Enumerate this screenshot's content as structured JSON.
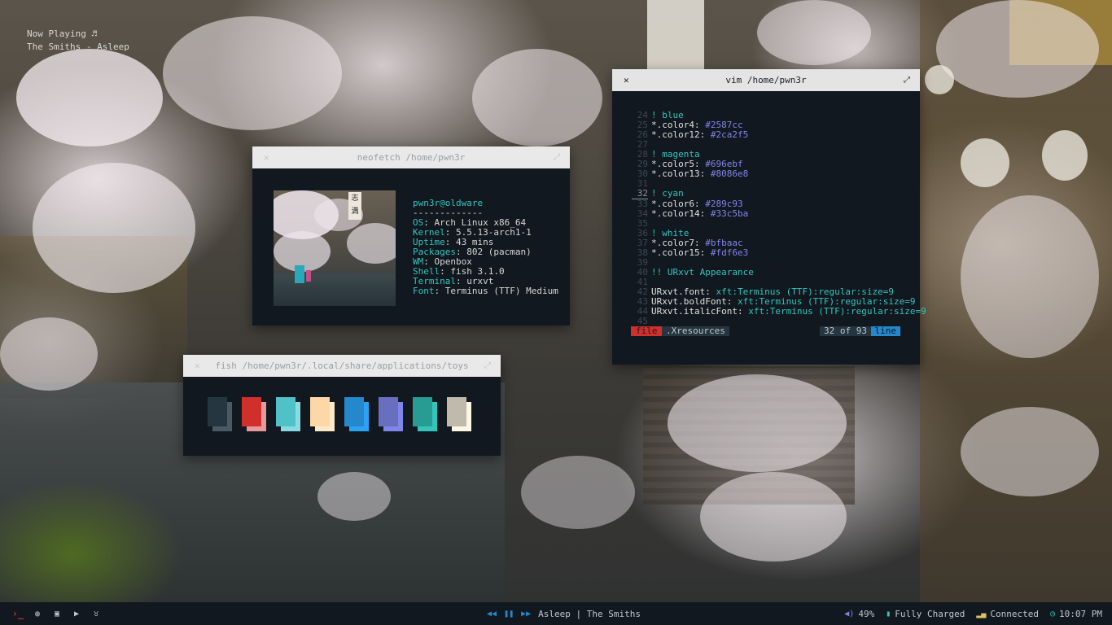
{
  "neofetch": {
    "title": "neofetch /home/pwn3r",
    "user_host": "pwn3r@oldware",
    "separator": "-------------",
    "rows": [
      {
        "key": "OS",
        "value": "Arch Linux x86_64"
      },
      {
        "key": "Kernel",
        "value": "5.5.13-arch1-1"
      },
      {
        "key": "Uptime",
        "value": "43 mins"
      },
      {
        "key": "Packages",
        "value": "802 (pacman)"
      },
      {
        "key": "WM",
        "value": "Openbox"
      },
      {
        "key": "Shell",
        "value": "fish 3.1.0"
      },
      {
        "key": "Terminal",
        "value": "urxvt"
      },
      {
        "key": "Font",
        "value": "Terminus (TTF) Medium"
      }
    ]
  },
  "fish": {
    "title": "fish /home/pwn3r/.local/share/applications/toys",
    "swatches": [
      {
        "front": "#263640",
        "back": "#4a5a64"
      },
      {
        "front": "#d12f2c",
        "back": "#e89a9a"
      },
      {
        "front": "#4fc1c7",
        "back": "#8adbdf"
      },
      {
        "front": "#fdd7a6",
        "back": "#ffe8c8"
      },
      {
        "front": "#2587cc",
        "back": "#2ca2f5"
      },
      {
        "front": "#696ebf",
        "back": "#8086e8"
      },
      {
        "front": "#289c93",
        "back": "#33c5ba"
      },
      {
        "front": "#bfbaac",
        "back": "#fdf6e3"
      }
    ]
  },
  "vim": {
    "title": "vim /home/pwn3r",
    "lines": [
      {
        "n": "24",
        "type": "comment",
        "text": "! blue"
      },
      {
        "n": "25",
        "type": "color",
        "key": "*.color4:",
        "val": "#2587cc"
      },
      {
        "n": "26",
        "type": "color",
        "key": "*.color12:",
        "val": "#2ca2f5"
      },
      {
        "n": "27",
        "type": "blank"
      },
      {
        "n": "28",
        "type": "comment",
        "text": "! magenta"
      },
      {
        "n": "29",
        "type": "color",
        "key": "*.color5:",
        "val": "#696ebf"
      },
      {
        "n": "30",
        "type": "color",
        "key": "*.color13:",
        "val": "#8086e8"
      },
      {
        "n": "31",
        "type": "blank"
      },
      {
        "n": "32",
        "type": "comment",
        "text": "! cyan",
        "current": true
      },
      {
        "n": "33",
        "type": "color",
        "key": "*.color6:",
        "val": "#289c93"
      },
      {
        "n": "34",
        "type": "color",
        "key": "*.color14:",
        "val": "#33c5ba"
      },
      {
        "n": "35",
        "type": "blank"
      },
      {
        "n": "36",
        "type": "comment",
        "text": "! white"
      },
      {
        "n": "37",
        "type": "color",
        "key": "*.color7:",
        "val": "#bfbaac"
      },
      {
        "n": "38",
        "type": "color",
        "key": "*.color15:",
        "val": "#fdf6e3"
      },
      {
        "n": "39",
        "type": "blank"
      },
      {
        "n": "40",
        "type": "comment",
        "text": "!! URxvt Appearance"
      },
      {
        "n": "41",
        "type": "blank"
      },
      {
        "n": "42",
        "type": "urxvt",
        "key": "URxvt.font:",
        "val": "xft:Terminus (TTF):regular:size=9"
      },
      {
        "n": "43",
        "type": "urxvt",
        "key": "URxvt.boldFont:",
        "val": "xft:Terminus (TTF):regular:size=9"
      },
      {
        "n": "44",
        "type": "urxvt",
        "key": "URxvt.italicFont:",
        "val": "xft:Terminus (TTF):regular:size=9"
      },
      {
        "n": "45",
        "type": "blank"
      }
    ],
    "status": {
      "mode": "file",
      "filename": ".Xresources",
      "position": "32 of 93",
      "unit": "line"
    }
  },
  "nowplaying": {
    "line1": "Now Playing ♬",
    "line2": "The Smiths - Asleep"
  },
  "bar": {
    "left_icons": [
      "terminal-icon",
      "browser-icon",
      "files-icon",
      "youtube-icon",
      "cat-icon"
    ],
    "track": "Asleep | The Smiths",
    "volume": "49%",
    "battery": "Fully Charged",
    "network": "Connected",
    "clock": "10:07 PM"
  },
  "colors": {
    "window_bg": "#121820",
    "titlebar_bg": "#e4e4e4",
    "accent_cyan": "#33c5ba",
    "accent_red": "#d12f2c",
    "accent_blue": "#2587cc",
    "accent_purple": "#8086e8"
  }
}
